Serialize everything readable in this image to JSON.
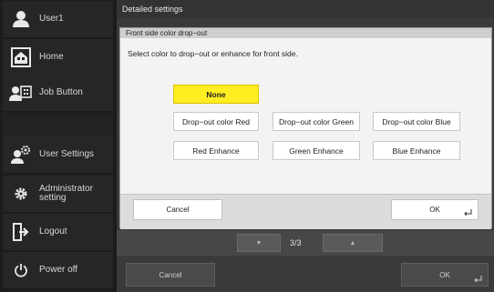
{
  "sidebar": {
    "items": [
      {
        "label": "User1",
        "icon": "user-icon"
      },
      {
        "label": "Home",
        "icon": "home-icon"
      },
      {
        "label": "Job Button",
        "icon": "job-button-icon"
      },
      {
        "label": "",
        "icon": ""
      },
      {
        "label": "User Settings",
        "icon": "user-settings-icon"
      },
      {
        "label": "Administrator\nsetting",
        "icon": "gear-icon"
      },
      {
        "label": "Logout",
        "icon": "logout-icon"
      },
      {
        "label": "Power off",
        "icon": "power-icon"
      }
    ]
  },
  "main": {
    "header": "Detailed settings",
    "pager": {
      "text": "3/3",
      "prev_icon": "triangle-down-icon",
      "next_icon": "triangle-up-icon"
    },
    "bottom": {
      "cancel": "Cancel",
      "ok": "OK"
    }
  },
  "dialog": {
    "title": "Front side color drop−out",
    "message": "Select color to drop−out or enhance for front side.",
    "options": {
      "none": "None",
      "dropout_red": "Drop−out color Red",
      "dropout_green": "Drop−out color Green",
      "dropout_blue": "Drop−out color Blue",
      "enhance_red": "Red Enhance",
      "enhance_green": "Green Enhance",
      "enhance_blue": "Blue Enhance"
    },
    "selected": "None",
    "selected_color": "#ffee22",
    "cancel": "Cancel",
    "ok": "OK"
  }
}
